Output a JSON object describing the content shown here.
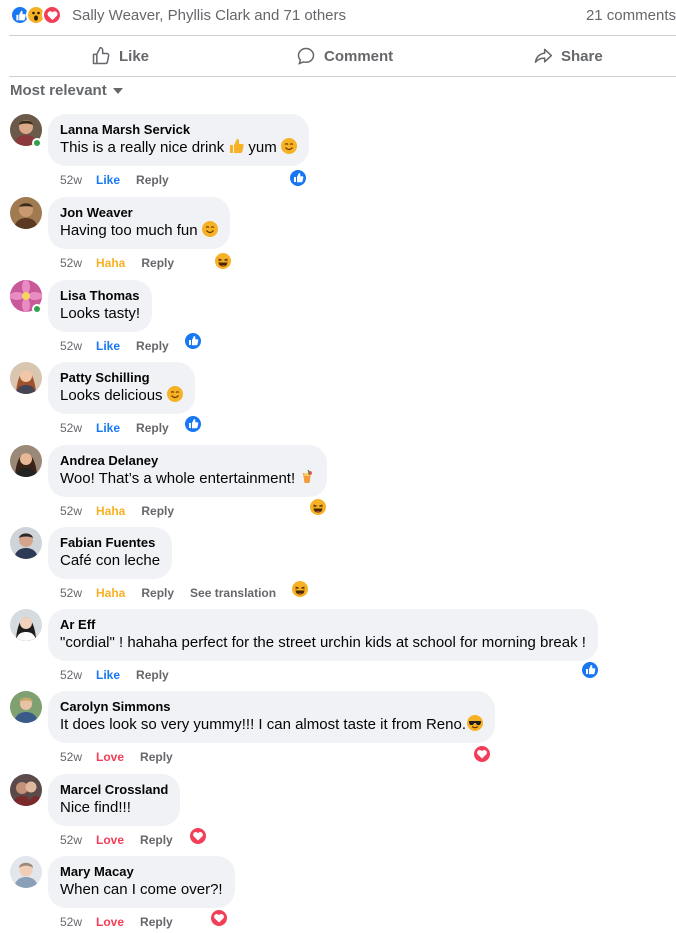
{
  "summary": {
    "names": "Sally Weaver, Phyllis Clark and 71 others",
    "comments_count": "21 comments",
    "reaction_icons": [
      "like-icon",
      "wow-icon",
      "love-icon"
    ]
  },
  "actions": {
    "like": "Like",
    "comment": "Comment",
    "share": "Share"
  },
  "sort": {
    "label": "Most relevant"
  },
  "colors": {
    "like": "#1877f2",
    "haha": "#f7b125",
    "love": "#f33e58",
    "bubble": "#f0f2f5",
    "muted": "#65676b",
    "online": "#31a24c"
  },
  "comments": [
    {
      "name": "Lanna Marsh Servick",
      "text": "This is a really nice drink",
      "emoji_after": "thumbs-up-icon",
      "text2": "yum",
      "emoji_end": "smiling-face-icon",
      "time": "52w",
      "reaction_label": "Like",
      "reaction_type": "like",
      "reply": "Reply",
      "badge": "like-icon",
      "online": true
    },
    {
      "name": "Jon Weaver",
      "text": "Having too much fun",
      "emoji_end": "smiling-face-icon",
      "time": "52w",
      "reaction_label": "Haha",
      "reaction_type": "haha",
      "reply": "Reply",
      "badge": "haha-icon",
      "online": false
    },
    {
      "name": "Lisa Thomas",
      "text": "Looks tasty!",
      "time": "52w",
      "reaction_label": "Like",
      "reaction_type": "like",
      "reply": "Reply",
      "badge": "like-icon",
      "online": true
    },
    {
      "name": "Patty Schilling",
      "text": "Looks delicious",
      "emoji_end": "smiling-face-icon",
      "time": "52w",
      "reaction_label": "Like",
      "reaction_type": "like",
      "reply": "Reply",
      "badge": "like-icon",
      "online": false
    },
    {
      "name": "Andrea Delaney",
      "text": "Woo! That’s a whole entertainment!",
      "emoji_end": "tropical-drink-icon",
      "time": "52w",
      "reaction_label": "Haha",
      "reaction_type": "haha",
      "reply": "Reply",
      "badge": "haha-icon",
      "online": false
    },
    {
      "name": "Fabian Fuentes",
      "text": "Café con leche",
      "time": "52w",
      "reaction_label": "Haha",
      "reaction_type": "haha",
      "reply": "Reply",
      "translate": "See translation",
      "badge": "haha-icon",
      "online": false
    },
    {
      "name": "Ar Eff",
      "text": "\"cordial\" ! hahaha perfect for the street urchin kids at school for morning break !",
      "time": "52w",
      "reaction_label": "Like",
      "reaction_type": "like",
      "reply": "Reply",
      "badge": "like-icon",
      "online": false
    },
    {
      "name": "Carolyn Simmons",
      "text": "It does look so very yummy!!! I can almost taste it from Reno.",
      "emoji_end": "sunglasses-face-icon",
      "time": "52w",
      "reaction_label": "Love",
      "reaction_type": "love",
      "reply": "Reply",
      "badge": "love-icon",
      "online": false
    },
    {
      "name": "Marcel Crossland",
      "text": "Nice find!!!",
      "time": "52w",
      "reaction_label": "Love",
      "reaction_type": "love",
      "reply": "Reply",
      "badge": "love-icon",
      "online": false
    },
    {
      "name": "Mary Macay",
      "text": "When can I come over?!",
      "time": "52w",
      "reaction_label": "Love",
      "reaction_type": "love",
      "reply": "Reply",
      "badge": "love-icon",
      "online": false
    }
  ]
}
